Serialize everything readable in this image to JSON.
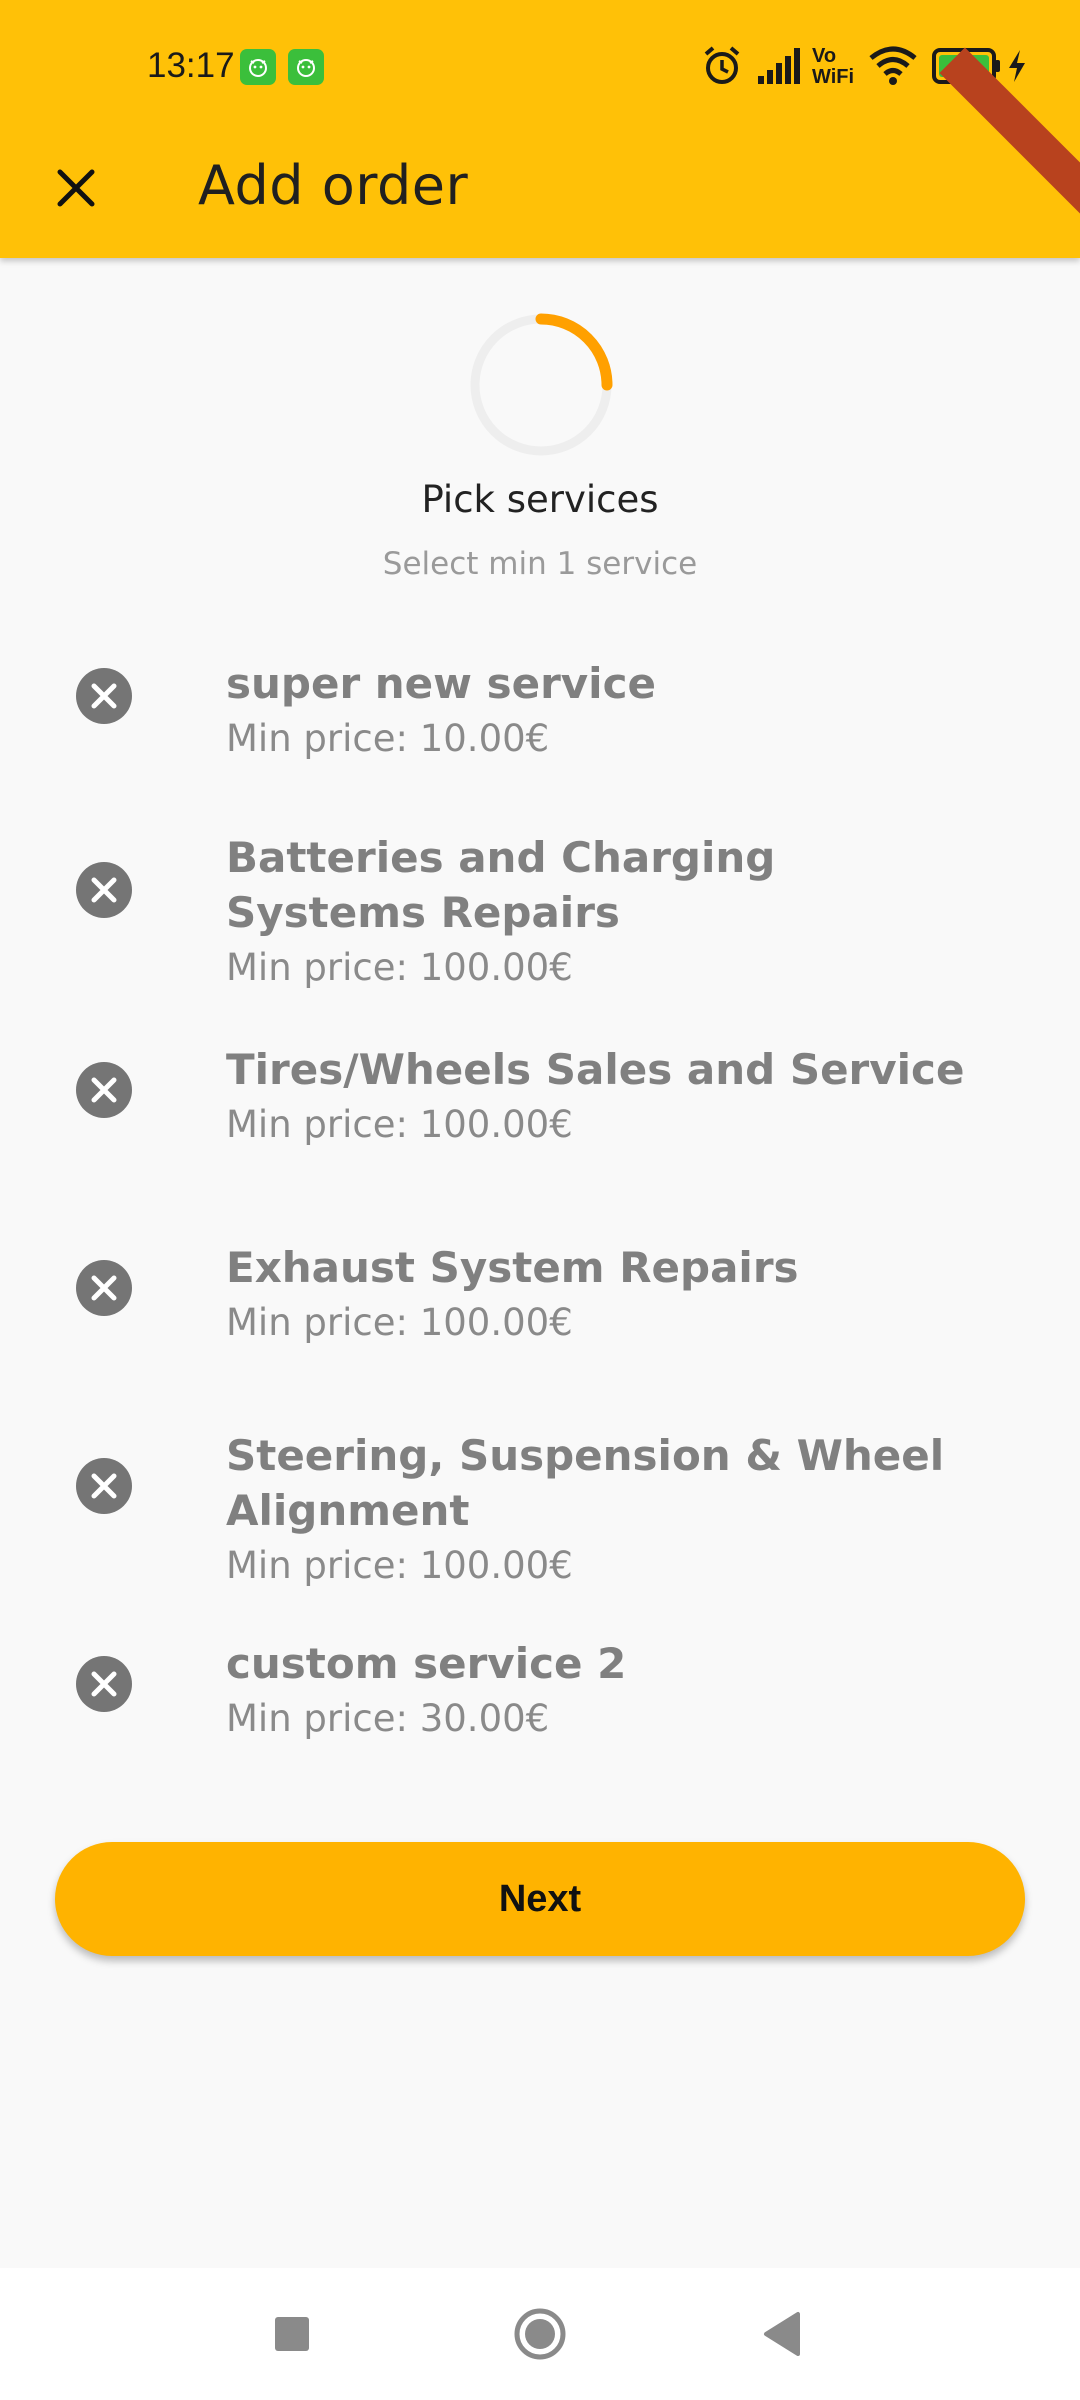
{
  "status_bar": {
    "time": "13:17",
    "battery_level": "90",
    "network_label_top": "Vo",
    "network_label_bottom": "WiFi"
  },
  "toolbar": {
    "title": "Add order"
  },
  "step": {
    "title": "Pick services",
    "subtitle": "Select min 1 service",
    "progress_fraction": 0.25
  },
  "services": [
    {
      "name": "super new service",
      "price": "Min price: 10.00€"
    },
    {
      "name": "Batteries and Charging Systems Repairs",
      "price": "Min price: 100.00€"
    },
    {
      "name": "Tires/Wheels Sales and Service",
      "price": "Min price: 100.00€"
    },
    {
      "name": "Exhaust System Repairs",
      "price": "Min price: 100.00€"
    },
    {
      "name": "Steering, Suspension & Wheel Alignment",
      "price": "Min price: 100.00€"
    },
    {
      "name": "custom service 2",
      "price": "Min price: 30.00€"
    }
  ],
  "next_label": "Next",
  "colors": {
    "app_bar": "#ffc107",
    "progress_arc": "#ffa000",
    "progress_track": "#eeeeee",
    "next_button": "#ffb300",
    "remove_icon": "#757575"
  }
}
